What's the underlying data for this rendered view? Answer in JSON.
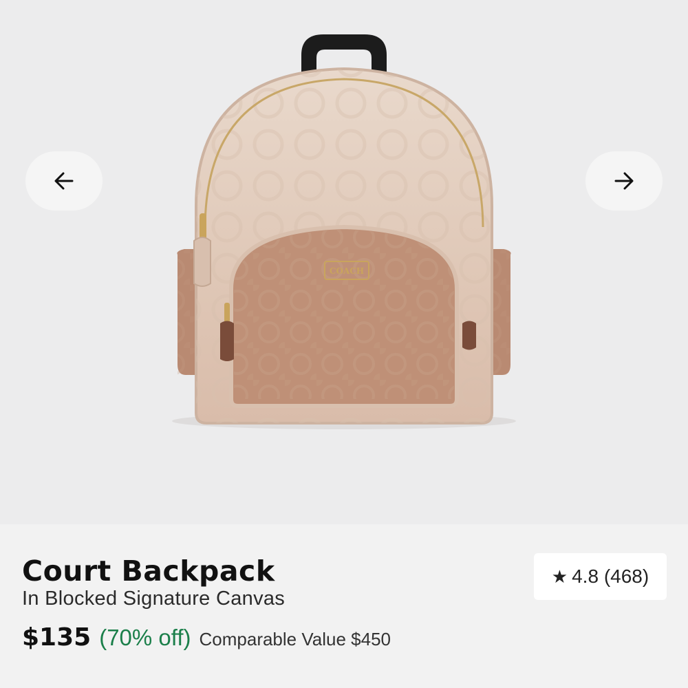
{
  "gallery": {
    "prev_icon": "arrow-left-icon",
    "next_icon": "arrow-right-icon",
    "image_alt": "Court Backpack",
    "brand_plate": "COACH"
  },
  "product": {
    "name": "Court Backpack",
    "variant": "In Blocked Signature Canvas",
    "price": "$135",
    "discount": "(70% off)",
    "comparable_value": "Comparable Value $450"
  },
  "rating": {
    "icon": "star-icon",
    "star": "★",
    "value": "4.8 (468)"
  },
  "colors": {
    "discount": "#1b7f4a",
    "background": "#ececed"
  }
}
